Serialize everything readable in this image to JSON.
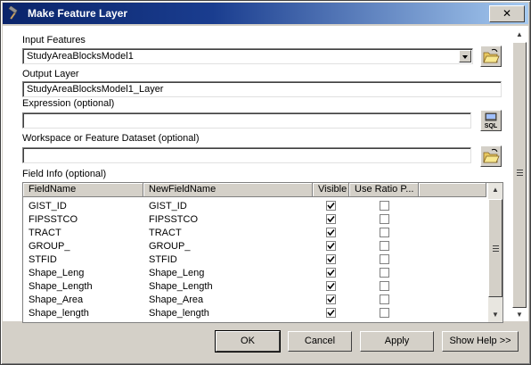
{
  "window": {
    "title": "Make Feature Layer"
  },
  "labels": {
    "input_features": "Input Features",
    "output_layer": "Output Layer",
    "expression": "Expression (optional)",
    "workspace": "Workspace or Feature Dataset (optional)",
    "field_info": "Field Info (optional)"
  },
  "values": {
    "input_features": "StudyAreaBlocksModel1",
    "output_layer": "StudyAreaBlocksModel1_Layer",
    "expression": "",
    "workspace": ""
  },
  "icons": {
    "expression_button": "SQL"
  },
  "grid": {
    "headers": [
      "FieldName",
      "NewFieldName",
      "Visible",
      "Use Ratio P..."
    ],
    "rows": [
      {
        "field": "GIST_ID",
        "new": "GIST_ID",
        "visible": true,
        "ratio": false
      },
      {
        "field": "FIPSSTCO",
        "new": "FIPSSTCO",
        "visible": true,
        "ratio": false
      },
      {
        "field": "TRACT",
        "new": "TRACT",
        "visible": true,
        "ratio": false
      },
      {
        "field": "GROUP_",
        "new": "GROUP_",
        "visible": true,
        "ratio": false
      },
      {
        "field": "STFID",
        "new": "STFID",
        "visible": true,
        "ratio": false
      },
      {
        "field": "Shape_Leng",
        "new": "Shape_Leng",
        "visible": true,
        "ratio": false
      },
      {
        "field": "Shape_Length",
        "new": "Shape_Length",
        "visible": true,
        "ratio": false
      },
      {
        "field": "Shape_Area",
        "new": "Shape_Area",
        "visible": true,
        "ratio": false
      },
      {
        "field": "Shape_length",
        "new": "Shape_length",
        "visible": true,
        "ratio": false
      }
    ]
  },
  "buttons": {
    "ok": "OK",
    "cancel": "Cancel",
    "apply": "Apply",
    "show_help": "Show Help >>"
  },
  "colors": {
    "titlebar_start": "#0a246a",
    "titlebar_end": "#a6caf0",
    "face": "#d4d0c8"
  }
}
